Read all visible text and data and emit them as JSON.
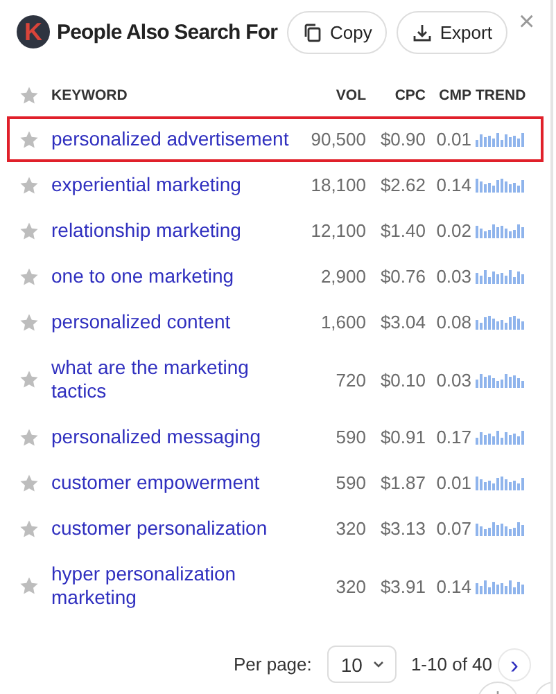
{
  "header": {
    "logo": "K",
    "title": "People Also Search For",
    "buttons": [
      {
        "kind": "copy",
        "label": "Copy"
      },
      {
        "kind": "export",
        "label": "Export"
      }
    ],
    "close": "×"
  },
  "table": {
    "columns": [
      "KEYWORD",
      "VOL",
      "CPC",
      "CMP",
      "TREND"
    ],
    "rows": [
      {
        "keyword": "personalized advertisement",
        "vol": "90,500",
        "cpc": "$0.90",
        "cmp": "0.01",
        "selected": true,
        "starred": false
      },
      {
        "keyword": "experiential marketing",
        "vol": "18,100",
        "cpc": "$2.62",
        "cmp": "0.14",
        "selected": false,
        "starred": false
      },
      {
        "keyword": "relationship marketing",
        "vol": "12,100",
        "cpc": "$1.40",
        "cmp": "0.02",
        "selected": false,
        "starred": false
      },
      {
        "keyword": "one to one marketing",
        "vol": "2,900",
        "cpc": "$0.76",
        "cmp": "0.03",
        "selected": false,
        "starred": false
      },
      {
        "keyword": "personalized content",
        "vol": "1,600",
        "cpc": "$3.04",
        "cmp": "0.08",
        "selected": false,
        "starred": false
      },
      {
        "keyword": "what are the marketing tactics",
        "vol": "720",
        "cpc": "$0.10",
        "cmp": "0.03",
        "selected": false,
        "starred": false
      },
      {
        "keyword": "personalized messaging",
        "vol": "590",
        "cpc": "$0.91",
        "cmp": "0.17",
        "selected": false,
        "starred": false
      },
      {
        "keyword": "customer empowerment",
        "vol": "590",
        "cpc": "$1.87",
        "cmp": "0.01",
        "selected": false,
        "starred": false
      },
      {
        "keyword": "customer personalization",
        "vol": "320",
        "cpc": "$3.13",
        "cmp": "0.07",
        "selected": false,
        "starred": false
      },
      {
        "keyword": "hyper personalization marketing",
        "vol": "320",
        "cpc": "$3.91",
        "cmp": "0.14",
        "selected": false,
        "starred": false
      }
    ]
  },
  "pagination": {
    "label": "Per page:",
    "per_page": "10",
    "range": "1-10 of 40",
    "next": "›"
  }
}
